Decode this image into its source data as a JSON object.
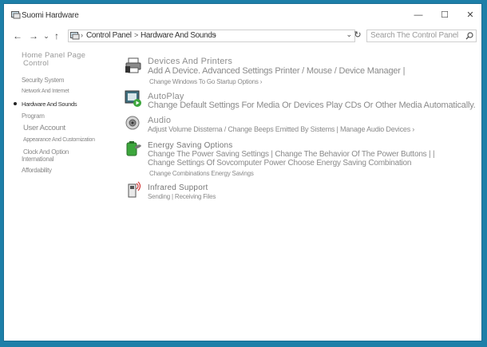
{
  "window": {
    "title": "Suomi Hardware"
  },
  "controls": {
    "minimize": "—",
    "maximize": "☐",
    "close": "✕"
  },
  "nav": {
    "back": "←",
    "forward": "→",
    "dropdown": "⌄",
    "up": "↑"
  },
  "address": {
    "sep1": "›",
    "crumb1": "Control Panel",
    "sep2": ">",
    "crumb2": "Hardware And Sounds",
    "sep3": "›",
    "dropdown": "⌄",
    "refresh": "↻"
  },
  "search": {
    "placeholder": "Search The Control Panel"
  },
  "sidebar": {
    "home_line1": "Home Panel Page",
    "home_line2": "Control",
    "items": [
      "Security System",
      "Network And Internet",
      "Hardware And Sounds",
      "Program",
      "User Account",
      "Appearance And Customization",
      "Clock And Option",
      "International",
      "Affordability"
    ]
  },
  "categories": [
    {
      "title": "Devices And Printers",
      "links": [
        "Add A Device. Advanced Settings Printer / Mouse / Device Manager  |",
        "Change Windows To Go Startup Options ›"
      ]
    },
    {
      "title": "AutoPlay",
      "links": [
        "Change Default Settings For Media Or Devices Play CDs Or Other Media Automatically."
      ]
    },
    {
      "title": "Audio",
      "links": [
        "Adjust Volume Dissterna / Change Beeps Emitted By Sistems | Manage Audio Devices ›"
      ]
    },
    {
      "title": "Energy Saving Options",
      "links": [
        "Change The Power Saving Settings | Change The Behavior Of The Power Buttons | |",
        "Change Settings Of Sovcomputer Power Choose Energy Saving Combination",
        "Change Combinations Energy Savings"
      ]
    },
    {
      "title": "Infrared Support",
      "links": [
        "Sending | Receiving Files"
      ]
    }
  ]
}
